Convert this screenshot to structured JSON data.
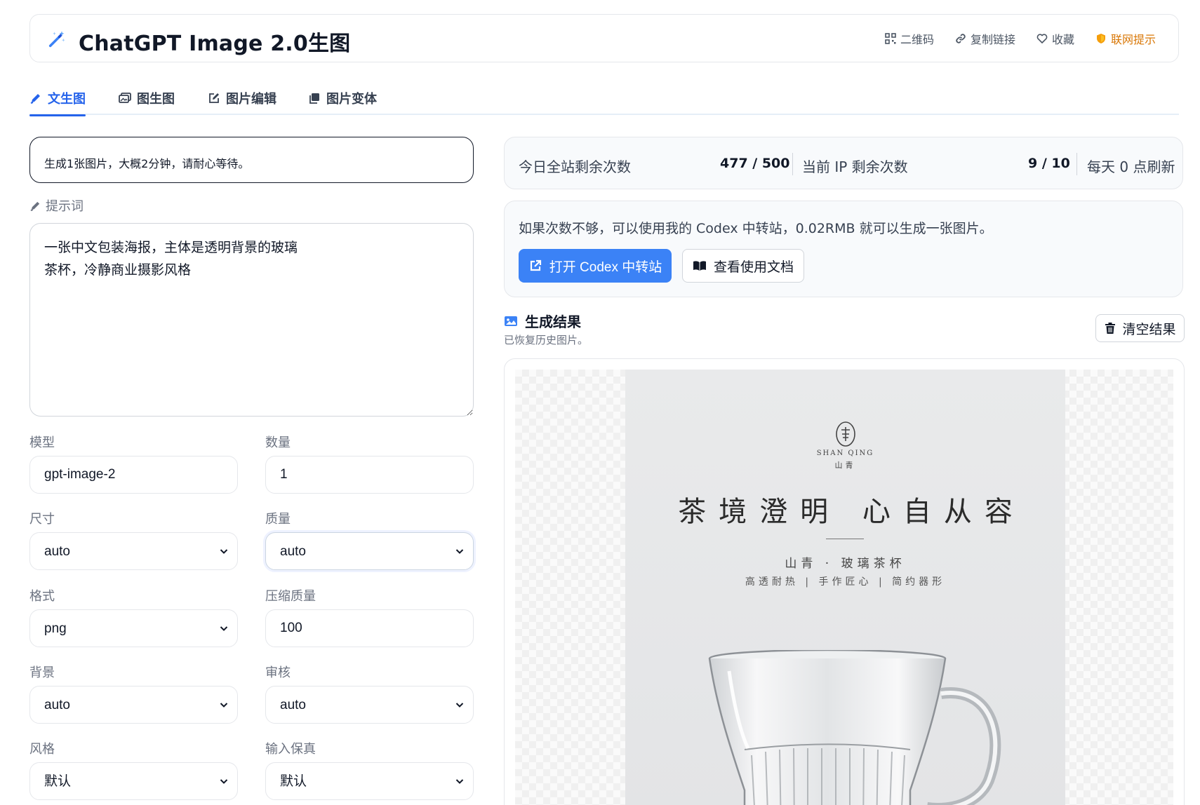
{
  "header": {
    "title": "ChatGPT Image 2.0生图",
    "actions": {
      "qrcode": "二维码",
      "copy_link": "复制链接",
      "favorite": "收藏",
      "network_tip": "联网提示"
    },
    "colors": {
      "accent": "#2563eb",
      "warn": "#d97706"
    }
  },
  "tabs": {
    "text_to_image": "文生图",
    "image_to_image": "图生图",
    "image_edit": "图片编辑",
    "image_variation": "图片变体"
  },
  "notice": "生成1张图片，大概2分钟，请耐心等待。",
  "prompt": {
    "label": "提示词",
    "value": "一张中文包装海报，主体是透明背景的玻璃\n茶杯，冷静商业摄影风格"
  },
  "form": {
    "model": {
      "label": "模型",
      "value": "gpt-image-2"
    },
    "count": {
      "label": "数量",
      "value": "1"
    },
    "size": {
      "label": "尺寸",
      "value": "auto"
    },
    "quality": {
      "label": "质量",
      "value": "auto"
    },
    "format": {
      "label": "格式",
      "value": "png"
    },
    "compression": {
      "label": "压缩质量",
      "value": "100"
    },
    "background": {
      "label": "背景",
      "value": "auto"
    },
    "moderation": {
      "label": "审核",
      "value": "auto"
    },
    "style": {
      "label": "风格",
      "value": "默认"
    },
    "input_fidelity": {
      "label": "输入保真",
      "value": "默认"
    }
  },
  "stats": {
    "site_label": "今日全站剩余次数",
    "site_value": "477 / 500",
    "ip_label": "当前 IP 剩余次数",
    "ip_value": "9 / 10",
    "refresh": "每天 0 点刷新"
  },
  "codex": {
    "message": "如果次数不够，可以使用我的 Codex 中转站，0.02RMB 就可以生成一张图片。",
    "open_button": "打开 Codex 中转站",
    "docs_button": "查看使用文档",
    "color": "#3b82f6"
  },
  "result": {
    "title": "生成结果",
    "subtitle": "已恢复历史图片。",
    "clear_button": "清空结果",
    "poster": {
      "brand_en": "SHAN QING",
      "brand_cn": "山青",
      "headline": "茶境澄明 心自从容",
      "line1": "山青 · 玻璃茶杯",
      "line2": "高透耐热 | 手作匠心 | 简约器形"
    }
  }
}
